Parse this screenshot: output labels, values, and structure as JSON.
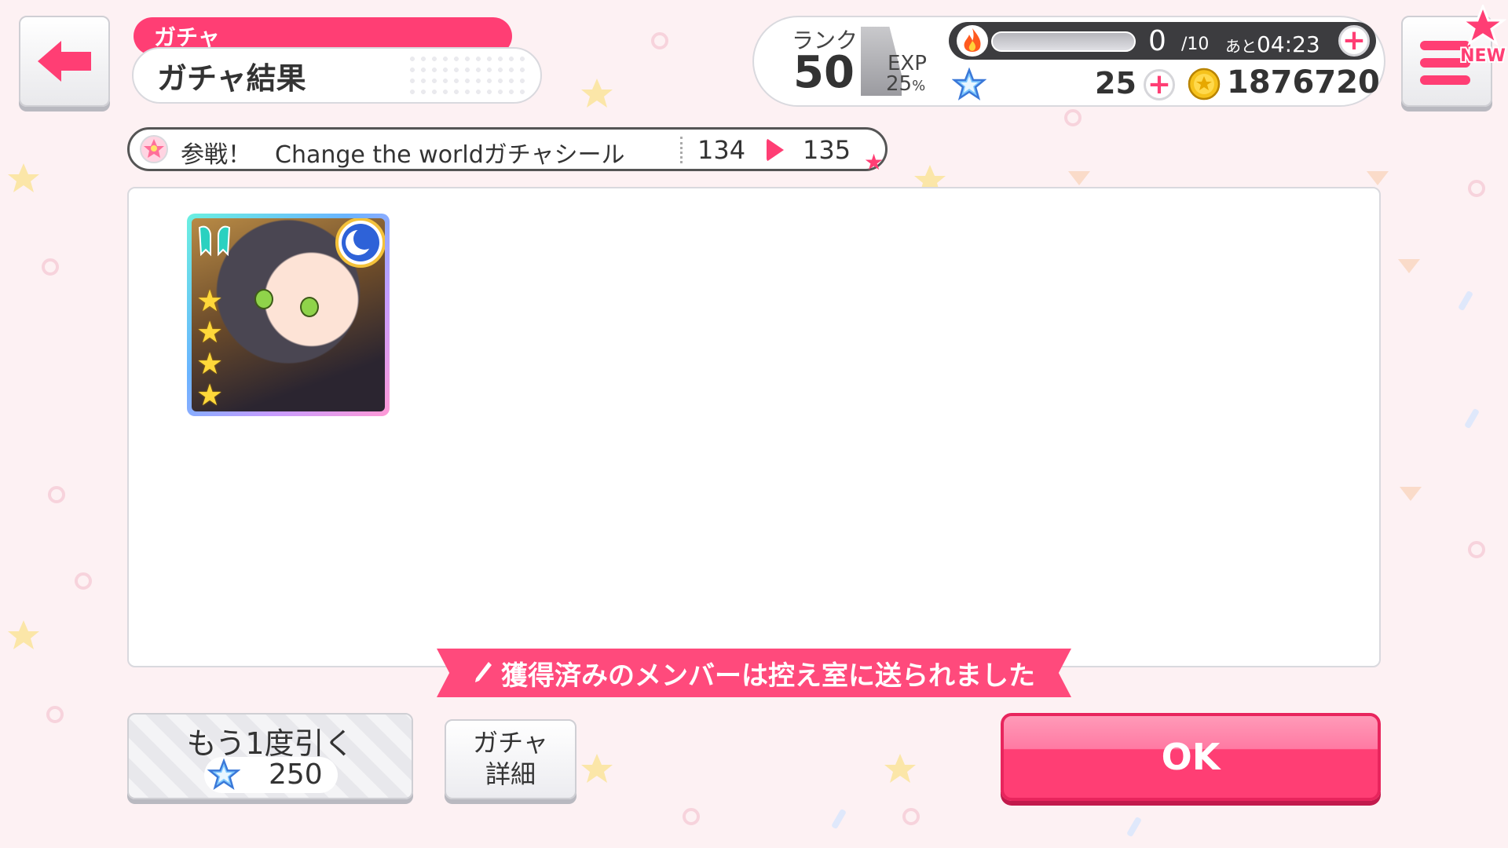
{
  "header": {
    "breadcrumb": "ガチャ",
    "title": "ガチャ結果"
  },
  "status": {
    "rank_label": "ランク",
    "rank_value": "50",
    "exp_label": "EXP",
    "exp_percent": "25",
    "exp_percent_unit": "%",
    "stamina_current": "0",
    "stamina_max": "/10",
    "stamina_timer_prefix": "あと",
    "stamina_timer": "04:23",
    "stamina_fill": 0,
    "star_count": "25",
    "coin_count": "1876720"
  },
  "menu": {
    "new_badge": "NEW"
  },
  "gacha_info": {
    "text": "参戦！　Change the worldガチャシール",
    "count_before": "134",
    "count_after": "135"
  },
  "result": {
    "card_rarity": 4,
    "notice": "獲得済みのメンバーは控え室に送られました"
  },
  "buttons": {
    "draw_again": "もう1度引く",
    "draw_cost": "250",
    "gacha_detail": "ガチャ\n詳細",
    "ok": "OK"
  },
  "colors": {
    "accent": "#ff3e74",
    "background": "#fdf1f3"
  }
}
